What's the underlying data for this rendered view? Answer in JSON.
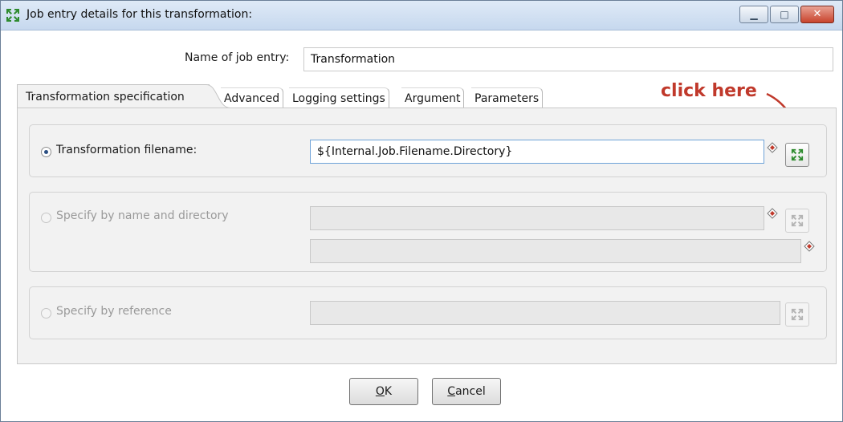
{
  "window": {
    "title": "Job entry details for this transformation:",
    "icon": "transformation-icon",
    "controls": {
      "minimize": "minimize-icon",
      "maximize": "maximize-icon",
      "close": "close-icon"
    }
  },
  "job_entry": {
    "label": "Name of job entry:",
    "value": "Transformation"
  },
  "tabs": [
    {
      "label": "Transformation specification",
      "active": true
    },
    {
      "label": "Advanced",
      "active": false
    },
    {
      "label": "Logging settings",
      "active": false
    },
    {
      "label": "Argument",
      "active": false
    },
    {
      "label": "Parameters",
      "active": false
    }
  ],
  "spec": {
    "filename": {
      "label": "Transformation filename:",
      "selected": true,
      "value": "${Internal.Job.Filename.Directory}"
    },
    "name_dir": {
      "label": "Specify by name and directory",
      "selected": false,
      "name_value": "",
      "dir_value": ""
    },
    "reference": {
      "label": "Specify by reference",
      "selected": false,
      "value": ""
    }
  },
  "annotation": {
    "text": "click here",
    "color": "#c0392b"
  },
  "buttons": {
    "ok_mnemonic": "O",
    "ok_rest": "K",
    "cancel_mnemonic": "C",
    "cancel_rest": "ancel"
  },
  "colors": {
    "icon_green": "#2e8b2e",
    "variable_icon_red": "#c0392b"
  }
}
